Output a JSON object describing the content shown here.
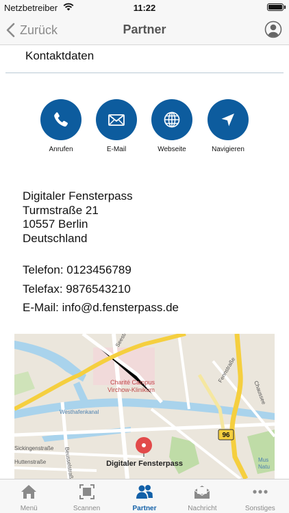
{
  "status_bar": {
    "carrier": "Netzbetreiber",
    "time": "11:22"
  },
  "nav": {
    "back_label": "Zurück",
    "title": "Partner",
    "user_icon": "user-circle-icon"
  },
  "section": {
    "title": "Kontaktdaten"
  },
  "actions": [
    {
      "label": "Anrufen",
      "icon": "phone-icon"
    },
    {
      "label": "E-Mail",
      "icon": "envelope-icon"
    },
    {
      "label": "Webseite",
      "icon": "globe-icon"
    },
    {
      "label": "Navigieren",
      "icon": "location-arrow-icon"
    }
  ],
  "address": {
    "name": "Digitaler Fensterpass",
    "street": "Turmstraße 21",
    "city": "10557 Berlin",
    "country": "Deutschland"
  },
  "contact": {
    "phone": "Telefon: 0123456789",
    "fax": "Telefax: 9876543210",
    "email": "E-Mail: info@d.fensterpass.de"
  },
  "map": {
    "pin_label": "Digitaler Fensterpass",
    "labels": {
      "seestr": "Seestraße",
      "charite1": "Charité Campus",
      "charite2": "Virchow-Klinikum",
      "westhafen": "Westhafenkanal",
      "fenn": "Fennstraße",
      "chaussee": "Chaussee",
      "beussel": "Beusselstraße",
      "huttenstr": "Huttenstraße",
      "sickingen": "Sickingenstraße",
      "route": "96",
      "mus1": "Mus",
      "mus2": "Natu"
    },
    "colors": {
      "water": "#a9d3ec",
      "major_road": "#f5cf3f",
      "park": "#bfdca7",
      "pin": "#e24a4a"
    }
  },
  "tabs": [
    {
      "label": "Menü",
      "icon": "home-icon",
      "active": false
    },
    {
      "label": "Scannen",
      "icon": "scan-icon",
      "active": false
    },
    {
      "label": "Partner",
      "icon": "partners-icon",
      "active": true
    },
    {
      "label": "Nachricht",
      "icon": "message-icon",
      "active": false
    },
    {
      "label": "Sonstiges",
      "icon": "more-icon",
      "active": false
    }
  ],
  "colors": {
    "accent": "#0d5c9e",
    "tab_active": "#1260a8",
    "tab_inactive": "#8a8a8a"
  }
}
